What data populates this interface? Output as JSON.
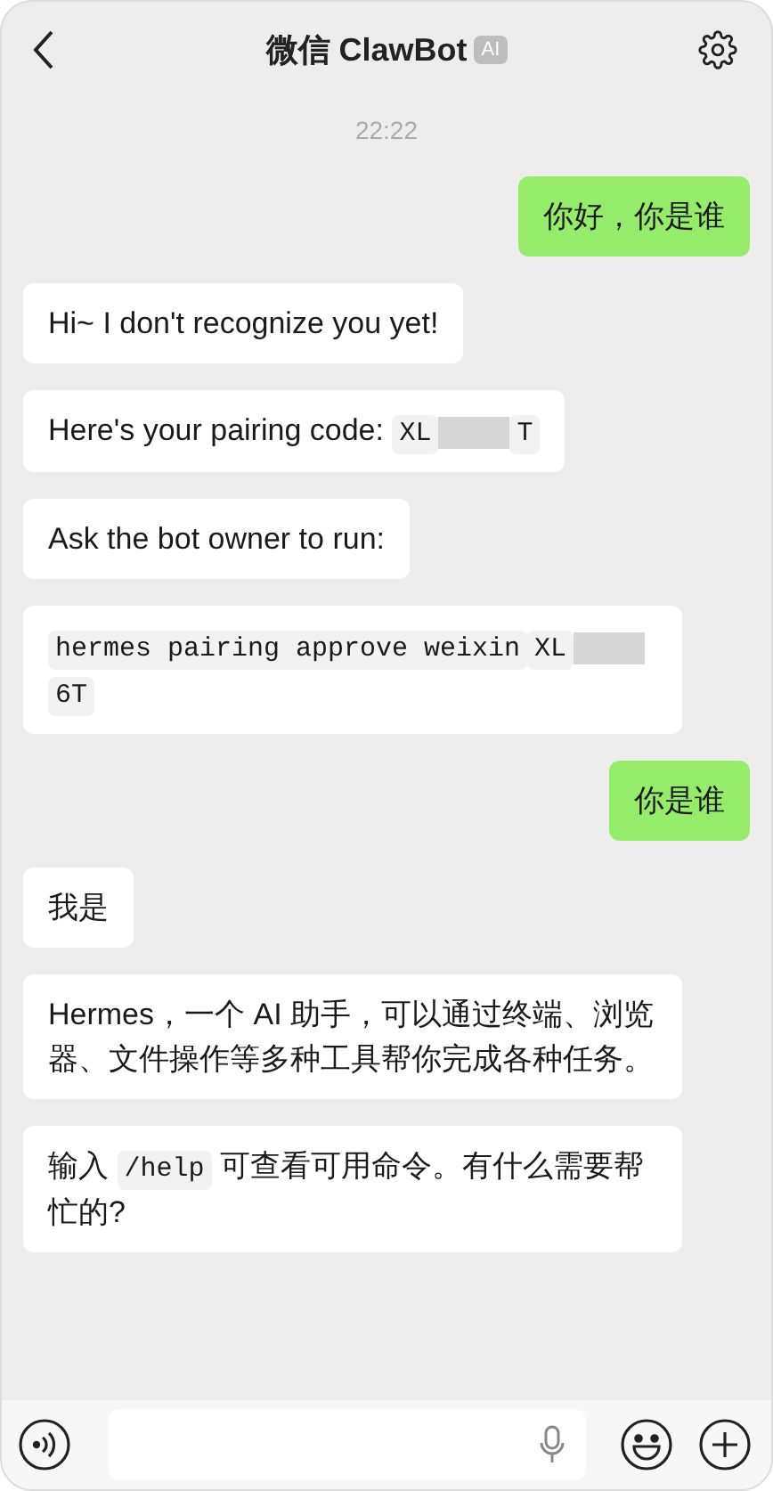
{
  "header": {
    "title": "微信 ClawBot",
    "badge": "AI"
  },
  "timestamp": "22:22",
  "messages": [
    {
      "kind": "sent",
      "segments": [
        {
          "kind": "text",
          "text": "你好，你是谁"
        }
      ]
    },
    {
      "kind": "received",
      "segments": [
        {
          "kind": "text",
          "text": "Hi~ I don't recognize you yet!"
        }
      ]
    },
    {
      "kind": "received",
      "segments": [
        {
          "kind": "text",
          "text": "Here's your pairing code: "
        },
        {
          "kind": "code",
          "text": "XL"
        },
        {
          "kind": "redacted"
        },
        {
          "kind": "code",
          "text": "T"
        }
      ]
    },
    {
      "kind": "received",
      "segments": [
        {
          "kind": "text",
          "text": "Ask the bot owner to run:"
        }
      ]
    },
    {
      "kind": "received",
      "segments": [
        {
          "kind": "code",
          "text": "hermes pairing approve weixin"
        },
        {
          "kind": "code",
          "text": "XL"
        },
        {
          "kind": "redacted"
        },
        {
          "kind": "code",
          "text": "6T"
        }
      ]
    },
    {
      "kind": "sent",
      "segments": [
        {
          "kind": "text",
          "text": "你是谁"
        }
      ]
    },
    {
      "kind": "received",
      "segments": [
        {
          "kind": "text",
          "text": "我是"
        }
      ]
    },
    {
      "kind": "received",
      "segments": [
        {
          "kind": "text",
          "text": "Hermes，一个 AI 助手，可以通过终端、浏览器、文件操作等多种工具帮你完成各种任务。"
        }
      ]
    },
    {
      "kind": "received",
      "segments": [
        {
          "kind": "text",
          "text": "输入 "
        },
        {
          "kind": "code",
          "text": "/help"
        },
        {
          "kind": "text",
          "text": " 可查看可用命令。有什么需要帮忙的?"
        }
      ]
    }
  ]
}
